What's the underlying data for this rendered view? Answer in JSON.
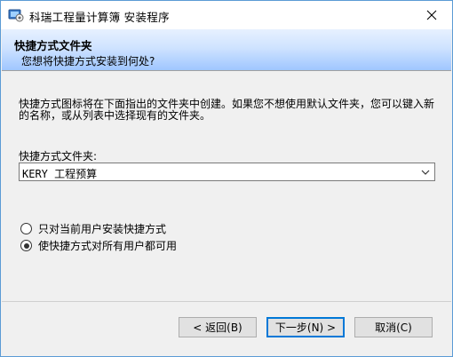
{
  "window": {
    "title": "科瑞工程量计算簿 安装程序",
    "close_glyph": "✕",
    "app_icon": "installer-icon"
  },
  "banner": {
    "title": "快捷方式文件夹",
    "subtitle": "您想将快捷方式安装到何处?"
  },
  "content": {
    "description": "快捷方式图标将在下面指出的文件夹中创建。如果您不想使用默认文件夹，您可以键入新的名称，或从列表中选择现有的文件夹。",
    "folder_label": "快捷方式文件夹:",
    "folder_value": "KERY 工程预算",
    "options": [
      {
        "label": "只对当前用户安装快捷方式",
        "checked": false
      },
      {
        "label": "使快捷方式对所有用户都可用",
        "checked": true
      }
    ]
  },
  "buttons": {
    "back": "< 返回(B)",
    "next": "下一步(N) >",
    "cancel": "取消(C)"
  },
  "colors": {
    "window_border": "#5b9bd5",
    "banner_bottom": "#9fc6ff",
    "default_button_border": "#0078d7"
  }
}
